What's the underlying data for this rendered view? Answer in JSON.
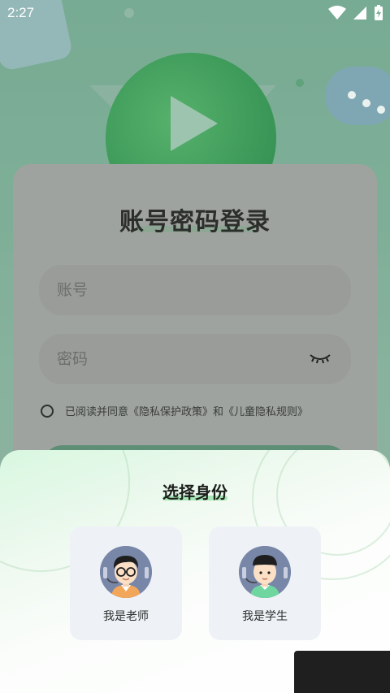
{
  "status_bar": {
    "time": "2:27"
  },
  "login": {
    "title": "账号密码登录",
    "account_placeholder": "账号",
    "password_placeholder": "密码",
    "agreement_text": "已阅读并同意《隐私保护政策》和《儿童隐私规则》"
  },
  "role_sheet": {
    "title": "选择身份",
    "roles": [
      {
        "label": "我是老师",
        "icon": "teacher-avatar-icon"
      },
      {
        "label": "我是学生",
        "icon": "student-avatar-icon"
      }
    ]
  },
  "colors": {
    "accent": "#3f9b5a",
    "title_highlight": "#a7e6b5",
    "avatar_bg": "#7886a8"
  }
}
